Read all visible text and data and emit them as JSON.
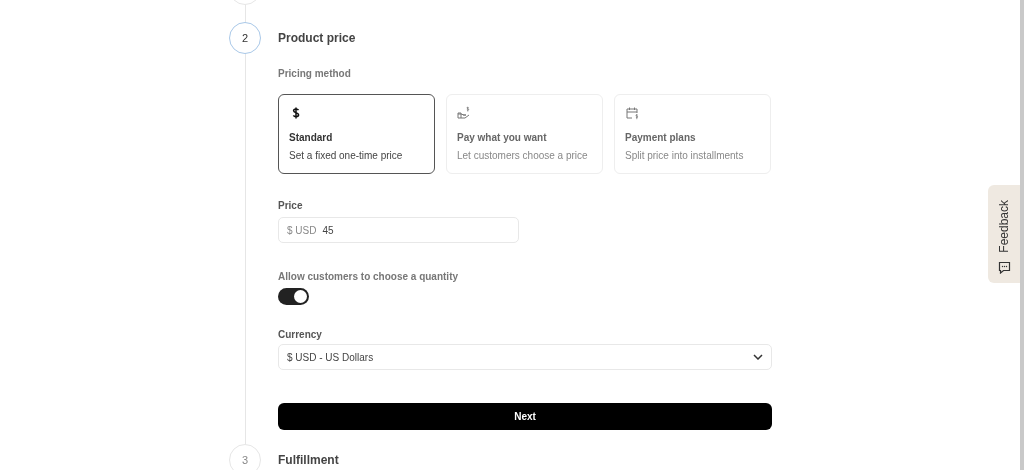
{
  "current_step": {
    "number": "2",
    "title": "Product price",
    "active": true
  },
  "pricing_method": {
    "label": "Pricing method",
    "options": [
      {
        "kind": "dollar",
        "title": "Standard",
        "description": "Set a fixed one-time price",
        "selected": true
      },
      {
        "kind": "hand",
        "title": "Pay what you want",
        "description": "Let customers choose a price",
        "selected": false
      },
      {
        "kind": "calendar",
        "title": "Payment plans",
        "description": "Split price into installments",
        "selected": false
      }
    ]
  },
  "price": {
    "label": "Price",
    "prefix": "$ USD",
    "value": "45"
  },
  "quantity": {
    "label": "Allow customers to choose a quantity",
    "on": true
  },
  "currency": {
    "label": "Currency",
    "value": "$ USD - US Dollars"
  },
  "next_button": "Next",
  "next_step": {
    "number": "3",
    "title": "Fulfillment",
    "active": false
  },
  "feedback": {
    "label": "Feedback"
  }
}
